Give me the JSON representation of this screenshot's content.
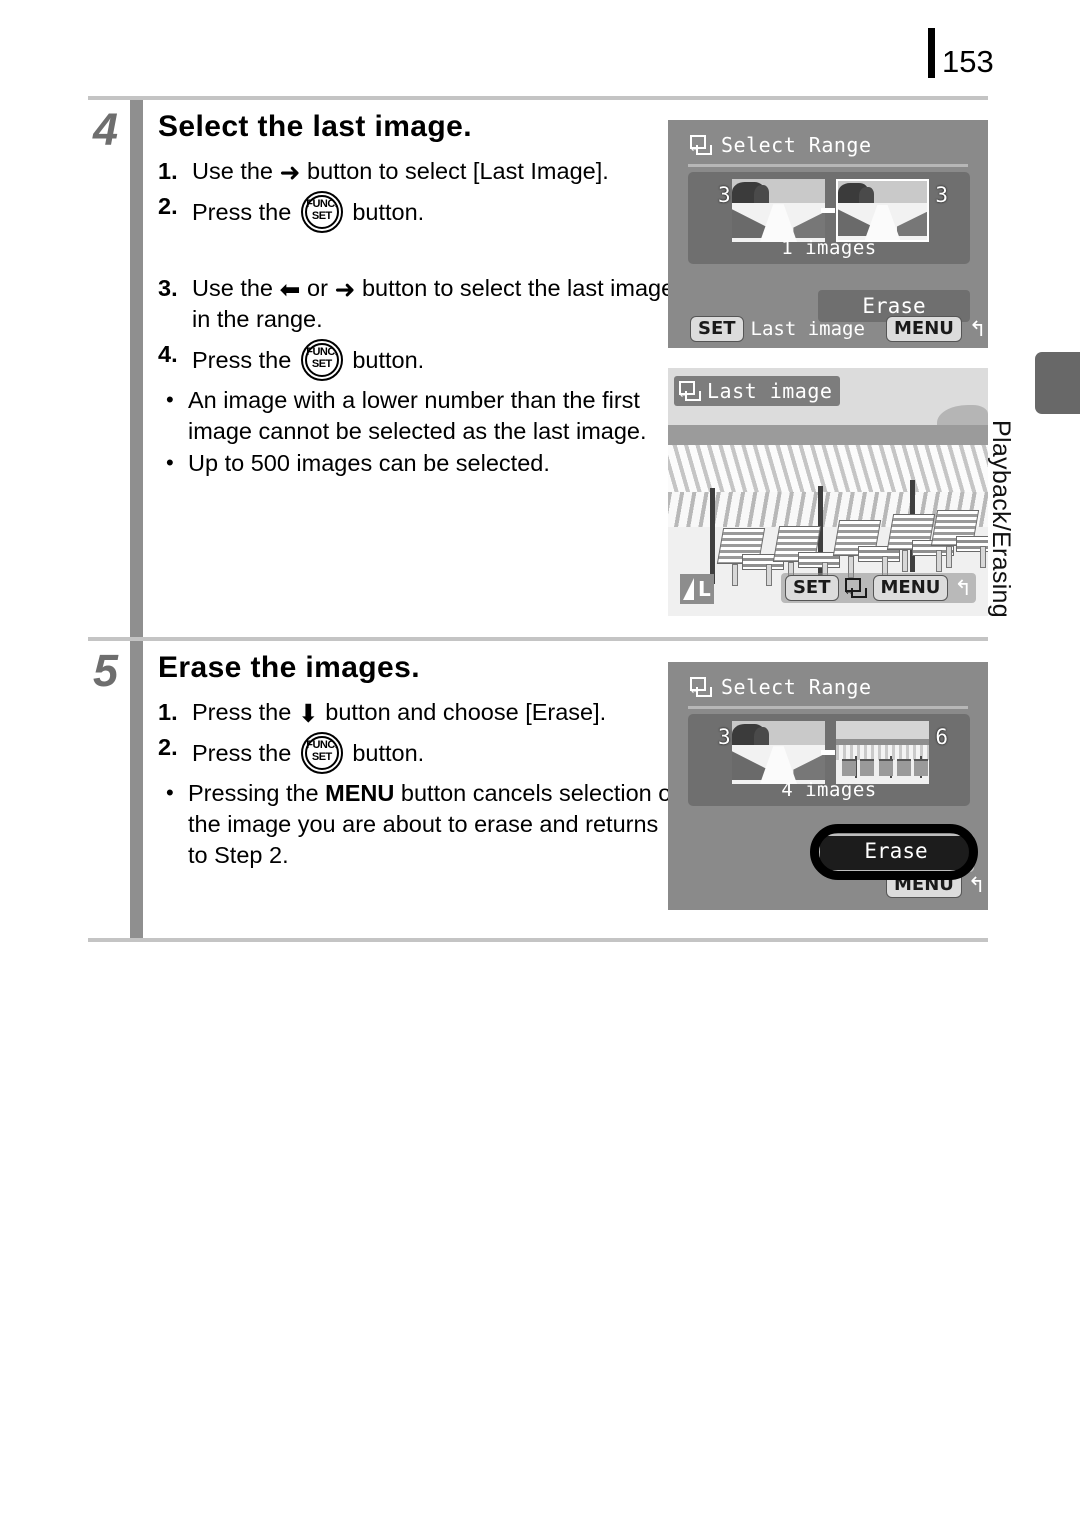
{
  "page": {
    "number": "153",
    "side_tab_label": "Playback/Erasing"
  },
  "steps": [
    {
      "number": "4",
      "title": "Select the last image.",
      "substeps": [
        {
          "marker": "1.",
          "parts": [
            "Use the ",
            "arrow-right",
            " button to select [Last Image]."
          ]
        },
        {
          "marker": "2.",
          "parts": [
            "Press the ",
            "func-set",
            " button."
          ]
        },
        {
          "marker": "3.",
          "parts": [
            "Use the ",
            "arrow-left",
            " or ",
            "arrow-right",
            " button to select the last image in the range."
          ]
        },
        {
          "marker": "4.",
          "parts": [
            "Press the ",
            "func-set",
            " button."
          ]
        }
      ],
      "bullets": [
        "An image with a lower number than the first image cannot be selected as the last image.",
        "Up to 500 images can be selected."
      ]
    },
    {
      "number": "5",
      "title": "Erase the images.",
      "substeps": [
        {
          "marker": "1.",
          "parts": [
            "Press the ",
            "arrow-down",
            " button and choose [Erase]."
          ]
        },
        {
          "marker": "2.",
          "parts": [
            "Press the ",
            "func-set",
            " button."
          ]
        }
      ],
      "bullets": [
        "Pressing the MENU button cancels selection of the image you are about to erase and returns to Step 2."
      ]
    }
  ],
  "step4_text": {
    "s1_a": "Use the",
    "s1_b": "button to select [Last Image].",
    "s2_a": "Press the",
    "s2_b": "button.",
    "s3_a": "Use the",
    "s3_b": "or",
    "s3_c": "button to select the last image in the range.",
    "s4_a": "Press the",
    "s4_b": "button.",
    "b1": "An image with a lower number than the first image cannot be selected as the last image.",
    "b2": "Up to 500 images can be selected."
  },
  "step5_text": {
    "s1_a": "Press the",
    "s1_b": "button and choose [Erase].",
    "s2_a": "Press the",
    "s2_b": "button.",
    "b1_a": "Pressing the",
    "b1_menu": "MENU",
    "b1_b": "button cancels selection of the image you are about to erase and returns to Step 2."
  },
  "func_set_button": {
    "top_label": "FUNC.",
    "bottom_label": "SET"
  },
  "glyphs": {
    "arrow_right": "➜",
    "arrow_left": "⬅",
    "arrow_down": "⬇",
    "bullet_dot": "•",
    "return_arrow": "↰"
  },
  "lcd_screens": [
    {
      "id": "select-range-initial",
      "title": "Select Range",
      "thumb_left_number": "3",
      "thumb_right_number": "3",
      "image_count": "1 images",
      "erase_label": "Erase",
      "set_badge": "SET",
      "set_label": "Last image",
      "menu_badge": "MENU",
      "return_arrow": "↰"
    },
    {
      "id": "last-image-selection",
      "title": "Last image",
      "quality_label": "L",
      "set_badge": "SET",
      "menu_badge": "MENU",
      "return_arrow": "↰"
    },
    {
      "id": "select-range-confirm",
      "title": "Select Range",
      "thumb_left_number": "3",
      "thumb_right_number": "6",
      "image_count": "4 images",
      "erase_label": "Erase",
      "menu_badge": "MENU",
      "return_arrow": "↰"
    }
  ],
  "colors": {
    "lcd_background": "#8a8a8a",
    "lcd_panel": "#6f6f6f",
    "step_bar": "#8f8f8f",
    "step_number": "#6e6e6e",
    "rule": "#c4c4c4",
    "side_tab": "#686868"
  }
}
